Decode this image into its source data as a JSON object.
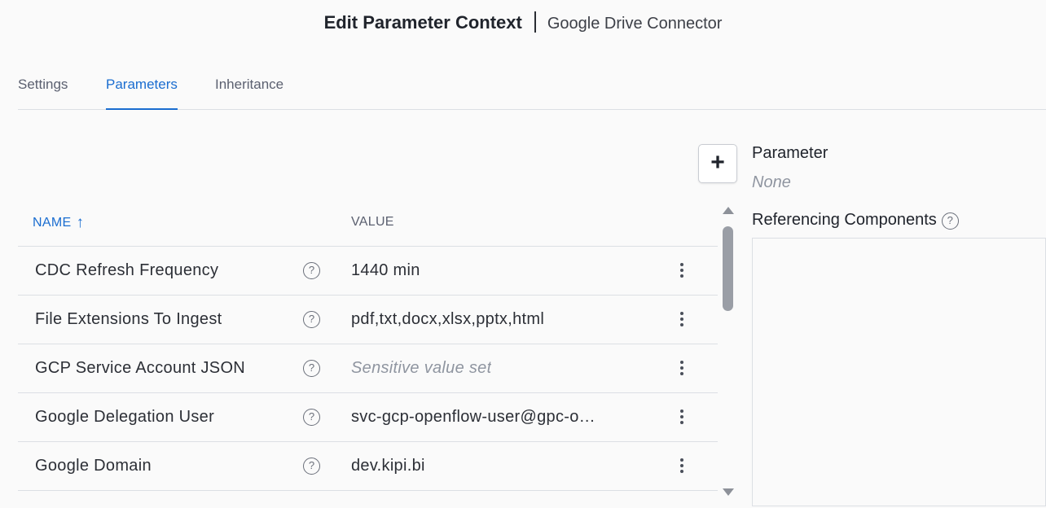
{
  "header": {
    "title": "Edit Parameter Context",
    "subtitle": "Google Drive Connector"
  },
  "tabs": [
    {
      "label": "Settings",
      "active": false
    },
    {
      "label": "Parameters",
      "active": true
    },
    {
      "label": "Inheritance",
      "active": false
    }
  ],
  "table": {
    "columns": {
      "name": "NAME",
      "value": "VALUE"
    },
    "sort": {
      "column": "name",
      "direction": "ascending",
      "icon": "arrow-up-icon"
    },
    "rows": [
      {
        "name": "CDC Refresh Frequency",
        "value": "1440 min",
        "sensitive": false
      },
      {
        "name": "File Extensions To Ingest",
        "value": "pdf,txt,docx,xlsx,pptx,html",
        "sensitive": false
      },
      {
        "name": "GCP Service Account JSON",
        "value": "Sensitive value set",
        "sensitive": true
      },
      {
        "name": "Google Delegation User",
        "value": "svc-gcp-openflow-user@gpc-o…",
        "sensitive": false
      },
      {
        "name": "Google Domain",
        "value": "dev.kipi.bi",
        "sensitive": false
      }
    ]
  },
  "add_button": {
    "label": "+"
  },
  "details": {
    "parameter_label": "Parameter",
    "parameter_value": "None",
    "referencing_label": "Referencing Components"
  },
  "icons": {
    "help": "?",
    "row_menu": "kebab-menu-icon"
  },
  "colors": {
    "accent": "#1a6dd0",
    "text": "#2c2f36",
    "muted": "#8f95a0"
  }
}
